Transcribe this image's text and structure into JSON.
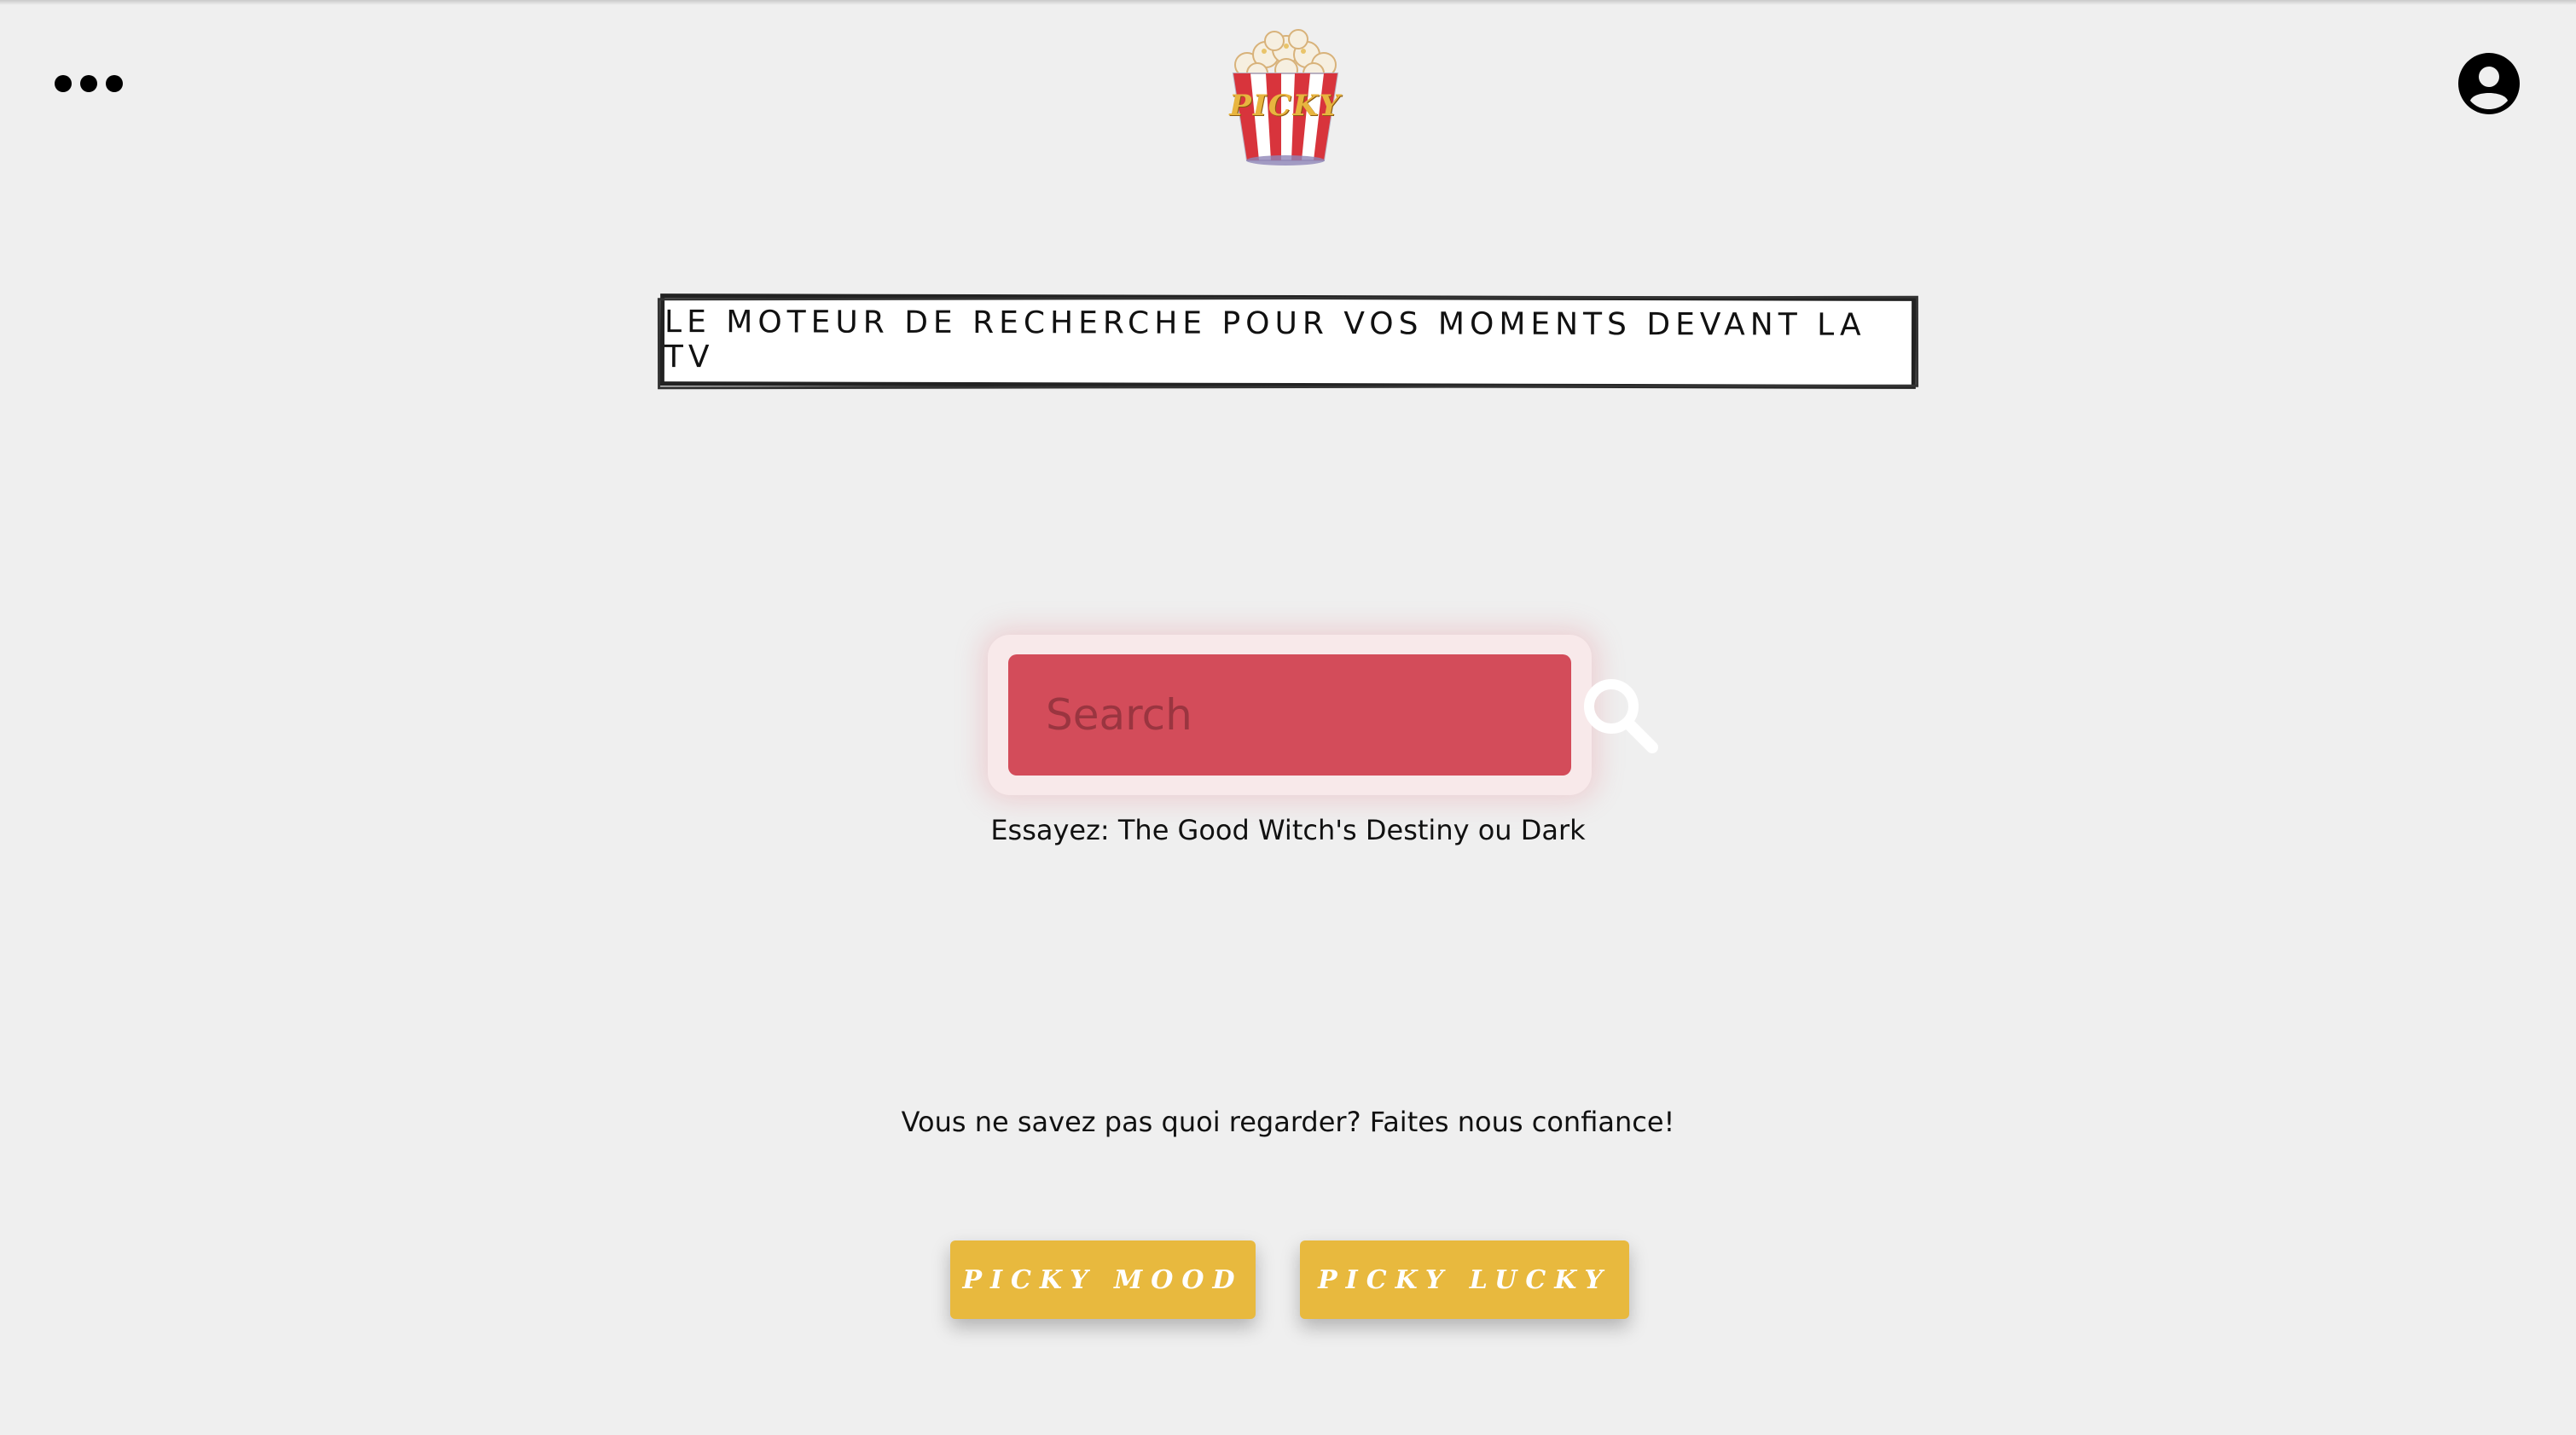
{
  "header": {
    "logo_text": "PICKY"
  },
  "tagline": "LE MOTEUR DE RECHERCHE POUR VOS MOMENTS DEVANT LA TV",
  "search": {
    "placeholder": "Search",
    "value": "",
    "hint": "Essayez: The Good Witch's Destiny ou Dark"
  },
  "discover": {
    "prompt": "Vous ne savez pas quoi regarder? Faites nous confiance!",
    "mood_label": "PICKY MOOD",
    "lucky_label": "PICKY LUCKY"
  },
  "icons": {
    "menu": "more-horizontal-icon",
    "user": "user-circle-icon",
    "search": "search-icon",
    "logo": "popcorn-icon"
  },
  "colors": {
    "background": "#efefef",
    "search_red": "#d34c5a",
    "button_yellow": "#e8b93e",
    "text": "#111111"
  }
}
